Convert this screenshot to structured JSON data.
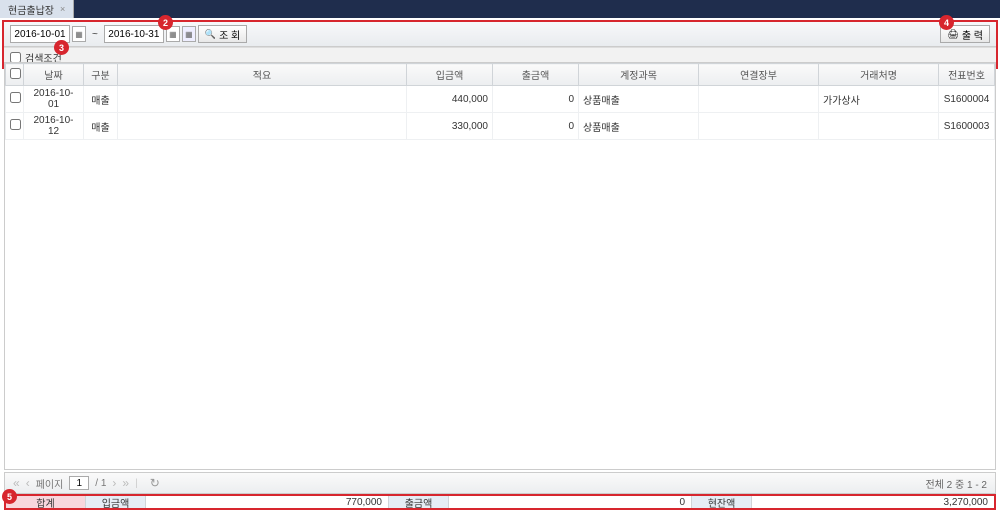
{
  "tab": {
    "title": "현금출납장"
  },
  "toolbar": {
    "date_from": "2016-10-01",
    "date_to": "2016-10-31",
    "search_label": "조 회",
    "print_label": "출 력",
    "search_cond_label": "검색조건"
  },
  "callouts": {
    "c2": "2",
    "c3": "3",
    "c4": "4",
    "c5": "5"
  },
  "grid": {
    "headers": {
      "date": "날짜",
      "type": "구분",
      "summary": "적요",
      "in_amount": "입금액",
      "out_amount": "출금액",
      "account": "계정과목",
      "dept": "연결장부",
      "partner": "거래처명",
      "voucher_no": "전표번호"
    },
    "rows": [
      {
        "date": "2016-10-01",
        "type": "매출",
        "summary": "",
        "in": "440,000",
        "out": "0",
        "account": "상품매출",
        "dept": "",
        "partner": "가가상사",
        "vno": "S1600004"
      },
      {
        "date": "2016-10-12",
        "type": "매출",
        "summary": "",
        "in": "330,000",
        "out": "0",
        "account": "상품매출",
        "dept": "",
        "partner": "",
        "vno": "S1600003"
      }
    ]
  },
  "pager": {
    "page_label_prefix": "페이지",
    "page": "1",
    "of_sep": "/ 1",
    "info": "전체 2 중 1 - 2"
  },
  "totals": {
    "main_label": "합계",
    "in_label": "입금액",
    "in_value": "770,000",
    "out_label": "출금액",
    "out_value": "0",
    "bal_label": "현잔액",
    "bal_value": "3,270,000"
  }
}
